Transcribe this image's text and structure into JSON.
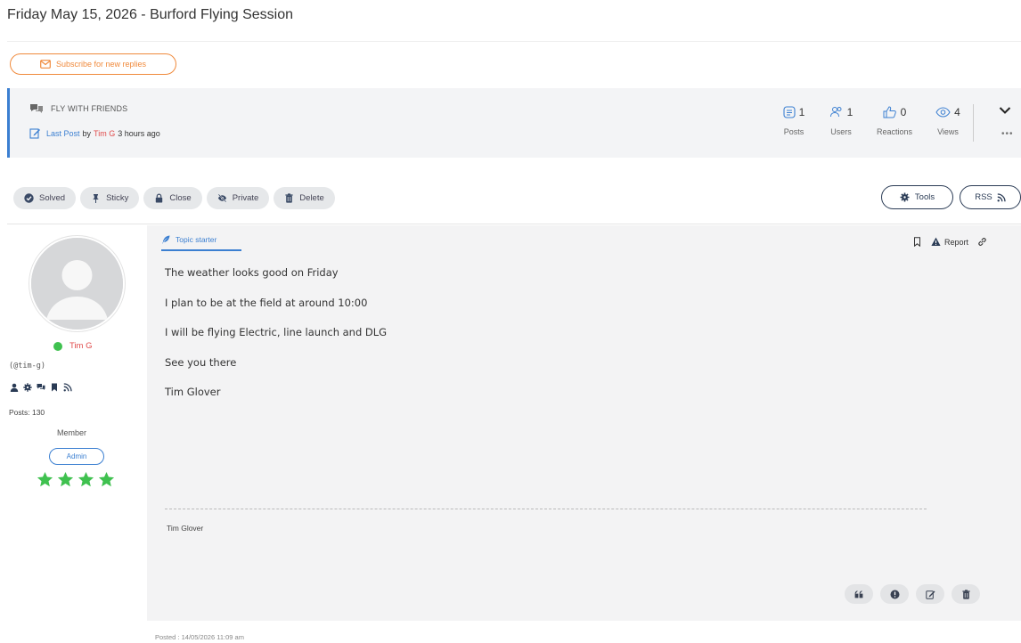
{
  "topic": {
    "title": "Friday May 15, 2026 - Burford Flying Session"
  },
  "subscribe": {
    "label": "Subscribe for new replies"
  },
  "forum_bar": {
    "forum_name": "FLY WITH FRIENDS",
    "last_post_label": "Last Post",
    "last_post_by": "by",
    "last_post_user": "Tim G",
    "last_post_time": "3 hours ago",
    "stats": [
      {
        "icon": "posts-icon",
        "value": "1",
        "label": "Posts"
      },
      {
        "icon": "users-icon",
        "value": "1",
        "label": "Users"
      },
      {
        "icon": "thumbs-up-icon",
        "value": "0",
        "label": "Reactions"
      },
      {
        "icon": "eye-icon",
        "value": "4",
        "label": "Views"
      }
    ],
    "more": "•••"
  },
  "actions": [
    {
      "icon": "check-circle-icon",
      "label": "Solved"
    },
    {
      "icon": "pin-icon",
      "label": "Sticky"
    },
    {
      "icon": "lock-icon",
      "label": "Close"
    },
    {
      "icon": "eye-slash-icon",
      "label": "Private"
    },
    {
      "icon": "trash-icon",
      "label": "Delete"
    }
  ],
  "tools": {
    "label": "Tools"
  },
  "rss": {
    "label": "RSS"
  },
  "author": {
    "name": "Tim G",
    "handle": "(@tim-g)",
    "posts": "Posts: 130",
    "role": "Member",
    "badge": "Admin",
    "stars": 4,
    "status": "online"
  },
  "post": {
    "tab_label": "Topic starter",
    "report_label": "Report",
    "lines": [
      "The weather looks good on Friday",
      "I plan to be at the field at around 10:00",
      "I will be flying Electric, line launch and DLG",
      "See you there",
      "Tim Glover"
    ],
    "signature": "Tim Glover",
    "posted": "Posted : 14/05/2026 11:09 am"
  },
  "colors": {
    "accent": "#3b7fd1",
    "subscribe": "#f08a3c",
    "author": "#e04b4b",
    "online": "#3fc14f",
    "stars": "#3fc14f"
  }
}
